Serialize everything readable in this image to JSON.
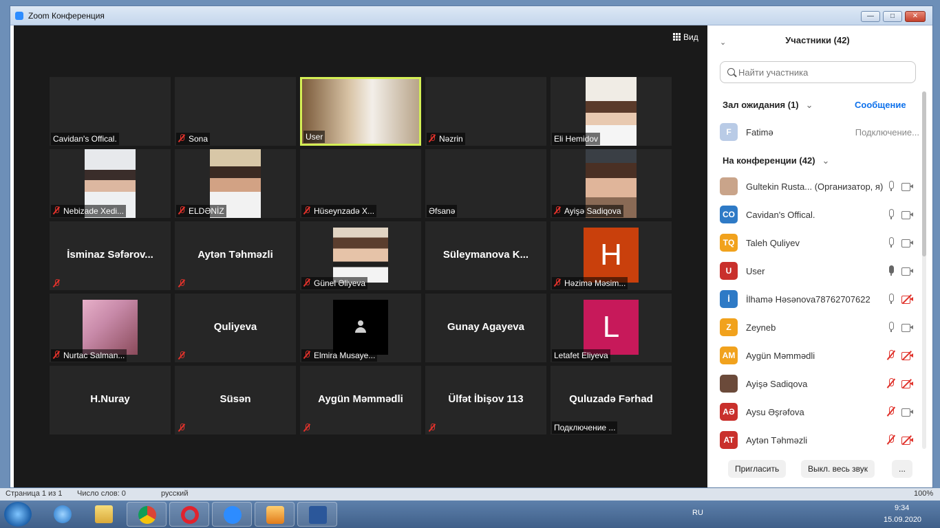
{
  "window": {
    "title": "Zoom Конференция",
    "min": "—",
    "max": "□",
    "close": "✕"
  },
  "video": {
    "view_label": "Вид",
    "tiles": [
      {
        "name": "Cavidan's Offical.",
        "muted": false,
        "kind": "blank"
      },
      {
        "name": "Sona",
        "muted": true,
        "kind": "blank"
      },
      {
        "name": "User",
        "muted": false,
        "kind": "video",
        "active": true
      },
      {
        "name": "Nəzrin",
        "muted": true,
        "kind": "blank"
      },
      {
        "name": "Eli Hemidov",
        "muted": false,
        "kind": "photo"
      },
      {
        "name": "Nebizade Xedi...",
        "muted": true,
        "kind": "photo"
      },
      {
        "name": "ELDƏNİZ",
        "muted": true,
        "kind": "photo"
      },
      {
        "name": "Hüseynzadə X...",
        "muted": true,
        "kind": "blank"
      },
      {
        "name": "Əfsanə",
        "muted": false,
        "kind": "blank"
      },
      {
        "name": "Ayişə Sadiqova",
        "muted": true,
        "kind": "photo"
      },
      {
        "name": "İsminaz Səfərov...",
        "muted": true,
        "kind": "bigname"
      },
      {
        "name": "Aytən Təhməzli",
        "muted": true,
        "kind": "bigname"
      },
      {
        "name": "Günel Əliyeva",
        "muted": true,
        "kind": "photo"
      },
      {
        "name": "Süleymanova K...",
        "muted": false,
        "kind": "bigname"
      },
      {
        "name": "Həzimə Məsim...",
        "muted": true,
        "kind": "letter",
        "letter": "H",
        "color": "#c9400c"
      },
      {
        "name": "Nurtac Salman...",
        "muted": true,
        "kind": "photo"
      },
      {
        "name": "Quliyeva",
        "muted": true,
        "kind": "bigname"
      },
      {
        "name": "Elmira Musaye...",
        "muted": true,
        "kind": "silhouette"
      },
      {
        "name": "Gunay Agayeva",
        "muted": false,
        "kind": "bigname"
      },
      {
        "name": "Letafet Eliyeva",
        "muted": false,
        "kind": "letter",
        "letter": "L",
        "color": "#c7195a"
      },
      {
        "name": "H.Nuray",
        "muted": false,
        "kind": "bigname"
      },
      {
        "name": "Süsən",
        "muted": true,
        "kind": "bigname"
      },
      {
        "name": "Aygün Məmmədli",
        "muted": true,
        "kind": "bigname"
      },
      {
        "name": "Ülfət İbişov 113",
        "muted": true,
        "kind": "bigname"
      },
      {
        "name": "Quluzadə Fərhad",
        "muted": false,
        "kind": "bigname",
        "status": "Подключение ..."
      }
    ]
  },
  "panel": {
    "title": "Участники (42)",
    "search_placeholder": "Найти участника",
    "waiting_label": "Зал ожидания (1)",
    "message_label": "Сообщение",
    "waiting": [
      {
        "initial": "F",
        "name": "Fatimə",
        "status": "Подключение...",
        "color": "#b9cbe6"
      }
    ],
    "conf_label": "На конференции (42)",
    "participants": [
      {
        "initials": "",
        "name": "Gultekin Rusta... (Организатор, я)",
        "color": "#c9a48a",
        "mic": "on",
        "cam": "on"
      },
      {
        "initials": "CO",
        "name": "Cavidan's Offical.",
        "color": "#2e7ac6",
        "mic": "on",
        "cam": "on"
      },
      {
        "initials": "TQ",
        "name": "Taleh Quliyev",
        "color": "#f1a21d",
        "mic": "on",
        "cam": "on"
      },
      {
        "initials": "U",
        "name": "User",
        "color": "#c9302c",
        "mic": "dark",
        "cam": "on"
      },
      {
        "initials": "İ",
        "name": "İlhamə Həsənova78762707622",
        "color": "#2e7ac6",
        "mic": "on",
        "cam": "off"
      },
      {
        "initials": "Z",
        "name": "Zeyneb",
        "color": "#f1a21d",
        "mic": "on",
        "cam": "on"
      },
      {
        "initials": "AM",
        "name": "Aygün Məmmədli",
        "color": "#f1a21d",
        "mic": "off",
        "cam": "off"
      },
      {
        "initials": "",
        "name": "Ayişə Sadiqova",
        "color": "#6b4a3a",
        "mic": "off",
        "cam": "off"
      },
      {
        "initials": "AƏ",
        "name": "Aysu Əşrəfova",
        "color": "#c9302c",
        "mic": "off",
        "cam": "on"
      },
      {
        "initials": "AT",
        "name": "Aytən Təhməzli",
        "color": "#c9302c",
        "mic": "off",
        "cam": "off"
      }
    ],
    "invite": "Пригласить",
    "mute_all": "Выкл. весь звук",
    "more": "..."
  },
  "statusbar": {
    "page": "Страница 1 из 1",
    "words": "Число слов: 0",
    "lang": "русский",
    "zoom": "100%"
  },
  "taskbar": {
    "lang": "RU",
    "time": "9:34",
    "date": "15.09.2020"
  }
}
